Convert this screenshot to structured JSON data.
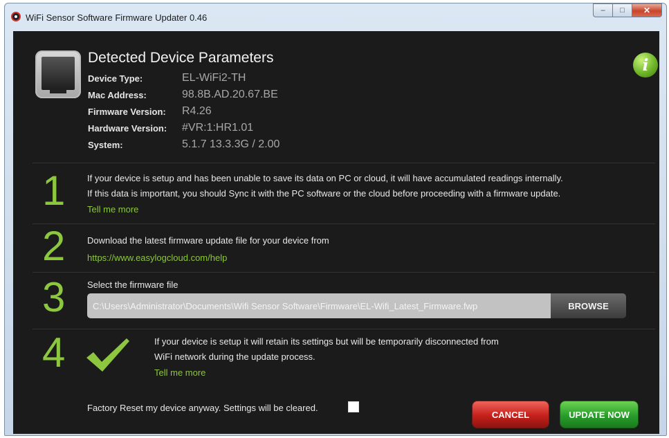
{
  "window": {
    "title": "WiFi Sensor Software Firmware Updater 0.46",
    "minimize_glyph": "‒",
    "maximize_glyph": "□",
    "close_glyph": "✕"
  },
  "header": {
    "title": "Detected Device Parameters",
    "info_glyph": "i",
    "params": [
      {
        "label": "Device Type:",
        "value": "EL-WiFi2-TH"
      },
      {
        "label": "Mac Address:",
        "value": "98.8B.AD.20.67.BE"
      },
      {
        "label": "Firmware Version:",
        "value": "R4.26"
      },
      {
        "label": "Hardware Version:",
        "value": "#VR:1:HR1.01"
      },
      {
        "label": "System:",
        "value": "5.1.7 13.3.3G / 2.00"
      }
    ]
  },
  "steps": {
    "one": {
      "number": "1",
      "line1": "If your device is setup and has been unable to save its data on PC or cloud, it will have accumulated readings internally.",
      "line2": "If this data is important, you should Sync it with the PC software or the cloud before proceeding with a firmware update.",
      "link": "Tell me more"
    },
    "two": {
      "number": "2",
      "text": "Download the latest firmware update file for your device from",
      "link": "https://www.easylogcloud.com/help"
    },
    "three": {
      "number": "3",
      "label": "Select the firmware file",
      "file_path": "C:\\Users\\Administrator\\Documents\\Wifi Sensor Software\\Firmware\\EL-Wifi_Latest_Firmware.fwp",
      "browse_label": "BROWSE"
    },
    "four": {
      "number": "4",
      "line1": "If your device is setup it will retain its settings but will be temporarily disconnected from",
      "line2": "WiFi network during the update process.",
      "link": "Tell me more"
    }
  },
  "footer": {
    "factory_reset_label": "Factory Reset my device anyway. Settings will be cleared.",
    "factory_reset_checked": false,
    "cancel_label": "CANCEL",
    "update_label": "UPDATE NOW"
  },
  "colors": {
    "accent_green": "#8dc63f",
    "background": "#1b1b1b",
    "cancel_red": "#c4201b",
    "update_green": "#289d2a"
  }
}
